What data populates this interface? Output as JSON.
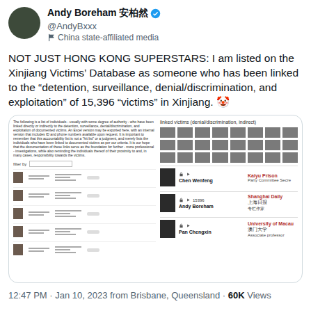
{
  "author": {
    "name": "Andy Boreham 安柏然",
    "verified": true,
    "handle": "@AndyBxxx",
    "label": "China state-affiliated media"
  },
  "tweet": {
    "text": "NOT JUST HONG KONG SUPERSTARS: I am listed on the Xinjiang Victims’ Database as someone who has been linked to the “detention, surveillance, denial/discrimination, and exploitation” of 15,396 “victims” in Xinjiang. 🤡"
  },
  "embed": {
    "intro": "The following is a list of individuals - usually with some degree of authority - who have been linked directly or indirectly to the detention, surveillance, denial/discrimination, and exploitation of documented victims. An Excel version may be exported here, with an internal version that includes ID and phone numbers available upon request. It is important to remember that this accountability list is not a \"hit list\" or a judgment, and merely lists the individuals who have been linked to documented victims as per our criteria. It is our hope that the documentation of these links serve as the foundation for further - more professional - investigations, while also reminding the individuals thereof of their proximity to and, in many cases, responsibility towards the victims.",
    "filter": "filter by",
    "panel_title": "linked victims (denial/discrimination, indirect)",
    "cards": [
      {
        "name": "Chen Wenfeng",
        "count": "",
        "org": "Kaiyu Prison",
        "org_zh": "",
        "role": "Party Committee Secre"
      },
      {
        "name": "Andy Boreham",
        "count": "15396",
        "org": "Shanghai Daily",
        "org_zh": "上海日报",
        "role": "专栏作家"
      },
      {
        "name": "Pan Chengxin",
        "count": "",
        "org": "University of Macau",
        "org_zh": "澳门大学",
        "role": "Associate professor"
      }
    ]
  },
  "meta": {
    "text": "12:47 PM · Jan 10, 2023 from Brisbane, Queensland ·",
    "views": "60K",
    "views_label": "Views"
  }
}
